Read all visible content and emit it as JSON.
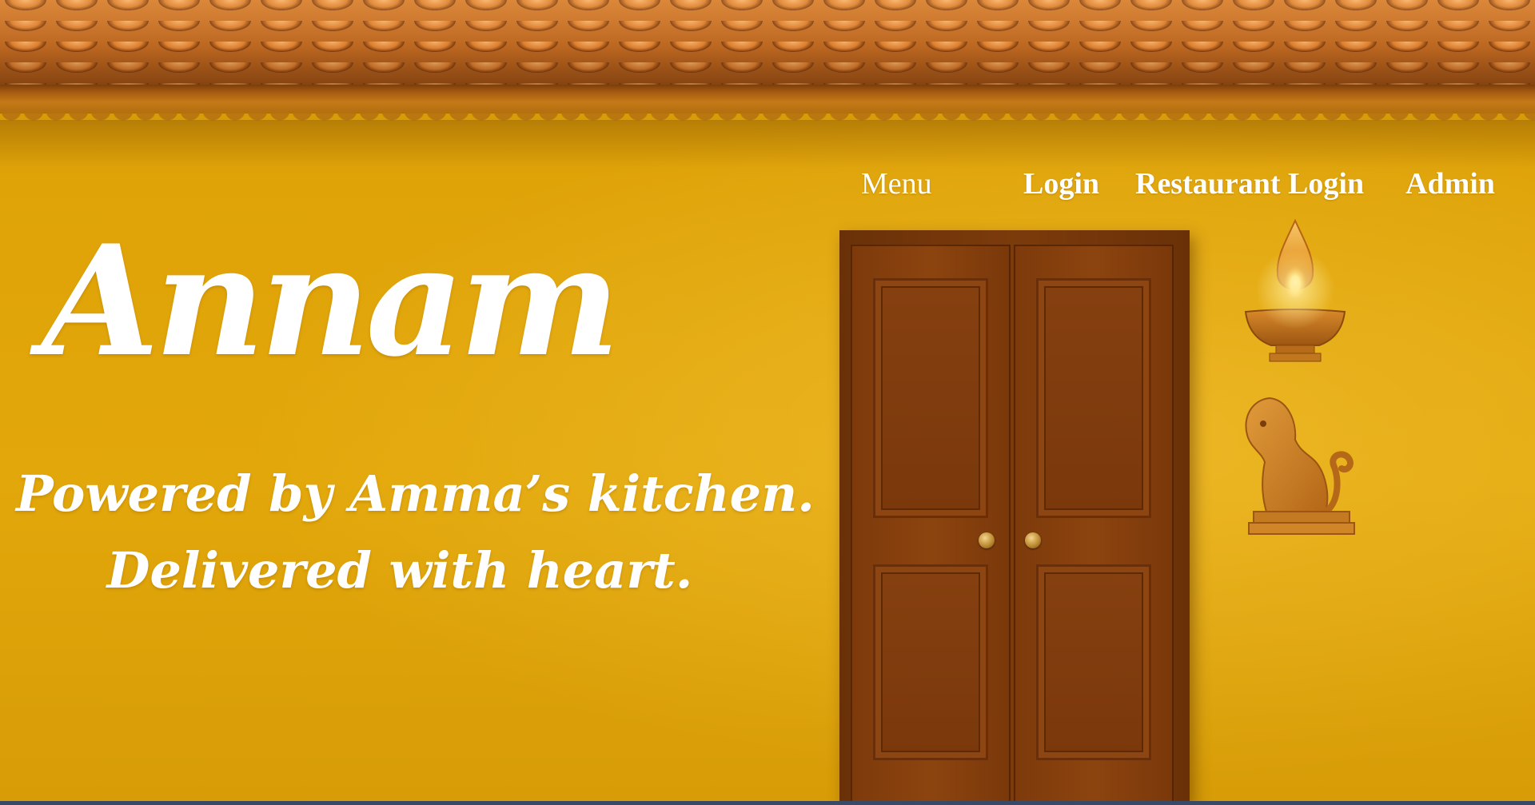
{
  "nav": {
    "menu": "Menu",
    "login": "Login",
    "restaurant_login": "Restaurant Login",
    "admin": "Admin"
  },
  "brand": {
    "logo_text": "Annam"
  },
  "hero": {
    "tagline_line1": "Powered by Amma’s kitchen.",
    "tagline_line2": "Delivered with heart."
  },
  "colors": {
    "wall": "#e0a509",
    "roof": "#c76a1c",
    "door": "#7d3a0b",
    "text": "#ffffff"
  },
  "icons": {
    "lamp": "oil-lamp-icon",
    "lion": "lion-statue-icon"
  }
}
